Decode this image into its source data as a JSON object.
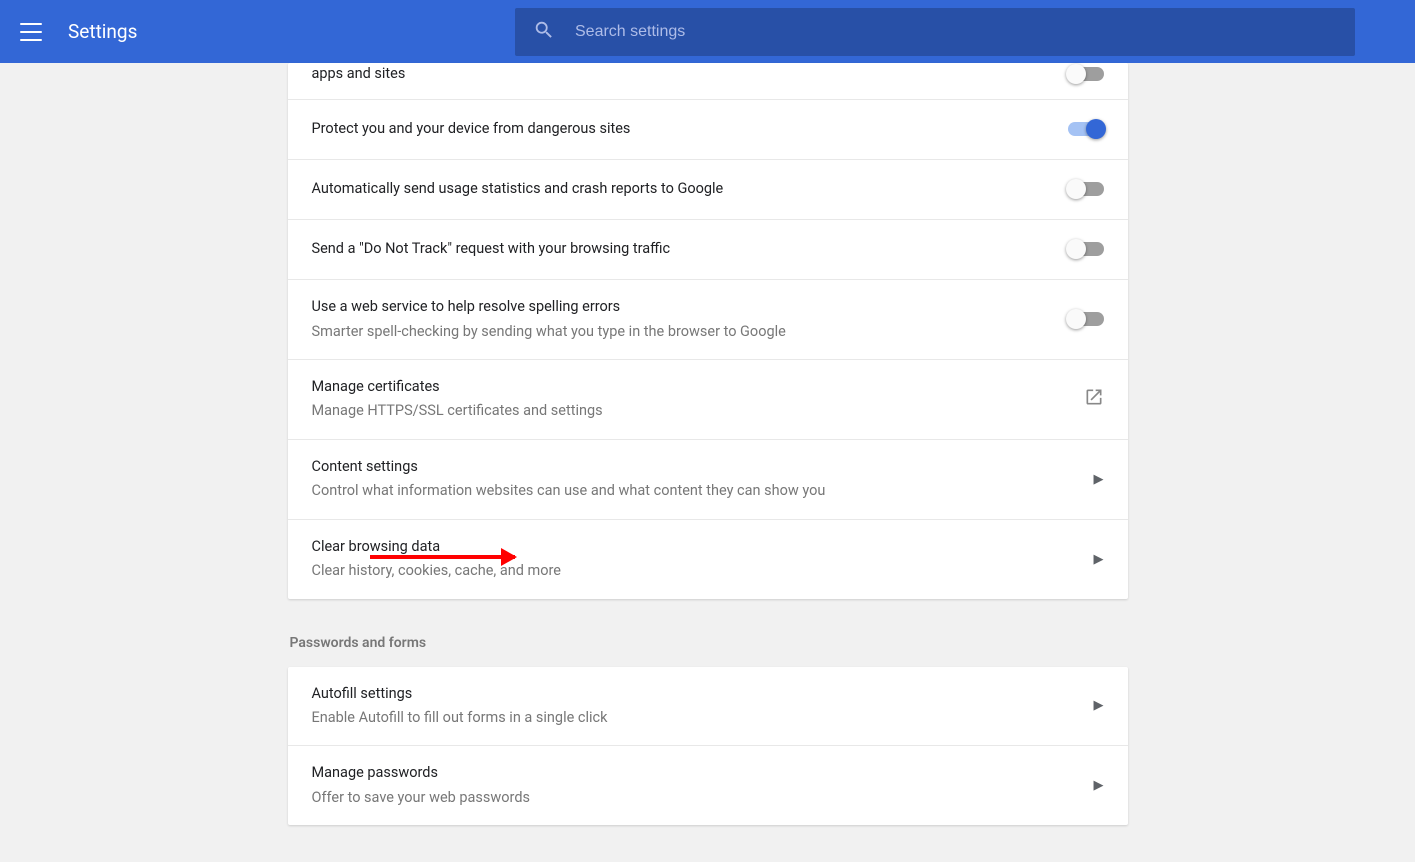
{
  "header": {
    "title": "Settings",
    "search_placeholder": "Search settings"
  },
  "privacy_rows": [
    {
      "title": "apps and sites",
      "sub": "",
      "type": "toggle",
      "on": false,
      "partial": true
    },
    {
      "title": "Protect you and your device from dangerous sites",
      "sub": "",
      "type": "toggle",
      "on": true
    },
    {
      "title": "Automatically send usage statistics and crash reports to Google",
      "sub": "",
      "type": "toggle",
      "on": false
    },
    {
      "title": "Send a \"Do Not Track\" request with your browsing traffic",
      "sub": "",
      "type": "toggle",
      "on": false
    },
    {
      "title": "Use a web service to help resolve spelling errors",
      "sub": "Smarter spell-checking by sending what you type in the browser to Google",
      "type": "toggle",
      "on": false
    },
    {
      "title": "Manage certificates",
      "sub": "Manage HTTPS/SSL certificates and settings",
      "type": "launch"
    },
    {
      "title": "Content settings",
      "sub": "Control what information websites can use and what content they can show you",
      "type": "nav"
    },
    {
      "title": "Clear browsing data",
      "sub": "Clear history, cookies, cache, and more",
      "type": "nav"
    }
  ],
  "section2_title": "Passwords and forms",
  "passwords_rows": [
    {
      "title": "Autofill settings",
      "sub": "Enable Autofill to fill out forms in a single click",
      "type": "nav"
    },
    {
      "title": "Manage passwords",
      "sub": "Offer to save your web passwords",
      "type": "nav"
    }
  ]
}
